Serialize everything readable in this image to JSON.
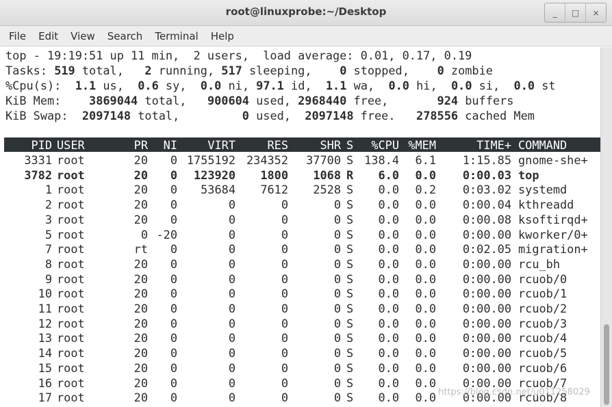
{
  "window": {
    "title": "root@linuxprobe:~/Desktop",
    "controls": {
      "minimize": "_",
      "maximize": "□",
      "close": "×"
    }
  },
  "menubar": {
    "items": [
      "File",
      "Edit",
      "View",
      "Search",
      "Terminal",
      "Help"
    ]
  },
  "summary": {
    "line1": "top - 19:19:51 up 11 min,  2 users,  load average: 0.01, 0.17, 0.19",
    "tasks": {
      "label": "Tasks:",
      "total": "519",
      "total_label": " total,",
      "running": "2",
      "running_label": " running,",
      "sleeping": "517",
      "sleeping_label": " sleeping,",
      "stopped": "0",
      "stopped_label": " stopped,",
      "zombie": "0",
      "zombie_label": " zombie"
    },
    "cpu": {
      "label": "%Cpu(s):",
      "us": "1.1",
      "us_label": " us,",
      "sy": "0.6",
      "sy_label": " sy,",
      "ni": "0.0",
      "ni_label": " ni,",
      "id": "97.1",
      "id_label": " id,",
      "wa": "1.1",
      "wa_label": " wa,",
      "hi": "0.0",
      "hi_label": " hi,",
      "si": "0.0",
      "si_label": " si,",
      "st": "0.0",
      "st_label": " st"
    },
    "mem": {
      "label": "KiB Mem:",
      "total": "3869044",
      "total_label": " total,",
      "used": "900604",
      "used_label": " used,",
      "free": "2968440",
      "free_label": " free,",
      "buffers": "924",
      "buffers_label": " buffers"
    },
    "swap": {
      "label": "KiB Swap:",
      "total": "2097148",
      "total_label": " total,",
      "used": "0",
      "used_label": " used,",
      "free": "2097148",
      "free_label": " free.",
      "cached": "278556",
      "cached_label": " cached Mem"
    }
  },
  "columns": [
    "PID",
    "USER",
    "PR",
    "NI",
    "VIRT",
    "RES",
    "SHR",
    "S",
    "%CPU",
    "%MEM",
    "TIME+",
    "COMMAND"
  ],
  "processes": [
    {
      "pid": "3331",
      "user": "root",
      "pr": "20",
      "ni": "0",
      "virt": "1755192",
      "res": "234352",
      "shr": "37700",
      "s": "S",
      "cpu": "138.4",
      "mem": "6.1",
      "time": "1:15.85",
      "command": "gnome-she+",
      "bold": false
    },
    {
      "pid": "3782",
      "user": "root",
      "pr": "20",
      "ni": "0",
      "virt": "123920",
      "res": "1800",
      "shr": "1068",
      "s": "R",
      "cpu": "6.0",
      "mem": "0.0",
      "time": "0:00.03",
      "command": "top",
      "bold": true
    },
    {
      "pid": "1",
      "user": "root",
      "pr": "20",
      "ni": "0",
      "virt": "53684",
      "res": "7612",
      "shr": "2528",
      "s": "S",
      "cpu": "0.0",
      "mem": "0.2",
      "time": "0:03.02",
      "command": "systemd",
      "bold": false
    },
    {
      "pid": "2",
      "user": "root",
      "pr": "20",
      "ni": "0",
      "virt": "0",
      "res": "0",
      "shr": "0",
      "s": "S",
      "cpu": "0.0",
      "mem": "0.0",
      "time": "0:00.04",
      "command": "kthreadd",
      "bold": false
    },
    {
      "pid": "3",
      "user": "root",
      "pr": "20",
      "ni": "0",
      "virt": "0",
      "res": "0",
      "shr": "0",
      "s": "S",
      "cpu": "0.0",
      "mem": "0.0",
      "time": "0:00.08",
      "command": "ksoftirqd+",
      "bold": false
    },
    {
      "pid": "5",
      "user": "root",
      "pr": "0",
      "ni": "-20",
      "virt": "0",
      "res": "0",
      "shr": "0",
      "s": "S",
      "cpu": "0.0",
      "mem": "0.0",
      "time": "0:00.00",
      "command": "kworker/0+",
      "bold": false
    },
    {
      "pid": "7",
      "user": "root",
      "pr": "rt",
      "ni": "0",
      "virt": "0",
      "res": "0",
      "shr": "0",
      "s": "S",
      "cpu": "0.0",
      "mem": "0.0",
      "time": "0:02.05",
      "command": "migration+",
      "bold": false
    },
    {
      "pid": "8",
      "user": "root",
      "pr": "20",
      "ni": "0",
      "virt": "0",
      "res": "0",
      "shr": "0",
      "s": "S",
      "cpu": "0.0",
      "mem": "0.0",
      "time": "0:00.00",
      "command": "rcu_bh",
      "bold": false
    },
    {
      "pid": "9",
      "user": "root",
      "pr": "20",
      "ni": "0",
      "virt": "0",
      "res": "0",
      "shr": "0",
      "s": "S",
      "cpu": "0.0",
      "mem": "0.0",
      "time": "0:00.00",
      "command": "rcuob/0",
      "bold": false
    },
    {
      "pid": "10",
      "user": "root",
      "pr": "20",
      "ni": "0",
      "virt": "0",
      "res": "0",
      "shr": "0",
      "s": "S",
      "cpu": "0.0",
      "mem": "0.0",
      "time": "0:00.00",
      "command": "rcuob/1",
      "bold": false
    },
    {
      "pid": "11",
      "user": "root",
      "pr": "20",
      "ni": "0",
      "virt": "0",
      "res": "0",
      "shr": "0",
      "s": "S",
      "cpu": "0.0",
      "mem": "0.0",
      "time": "0:00.00",
      "command": "rcuob/2",
      "bold": false
    },
    {
      "pid": "12",
      "user": "root",
      "pr": "20",
      "ni": "0",
      "virt": "0",
      "res": "0",
      "shr": "0",
      "s": "S",
      "cpu": "0.0",
      "mem": "0.0",
      "time": "0:00.00",
      "command": "rcuob/3",
      "bold": false
    },
    {
      "pid": "13",
      "user": "root",
      "pr": "20",
      "ni": "0",
      "virt": "0",
      "res": "0",
      "shr": "0",
      "s": "S",
      "cpu": "0.0",
      "mem": "0.0",
      "time": "0:00.00",
      "command": "rcuob/4",
      "bold": false
    },
    {
      "pid": "14",
      "user": "root",
      "pr": "20",
      "ni": "0",
      "virt": "0",
      "res": "0",
      "shr": "0",
      "s": "S",
      "cpu": "0.0",
      "mem": "0.0",
      "time": "0:00.00",
      "command": "rcuob/5",
      "bold": false
    },
    {
      "pid": "15",
      "user": "root",
      "pr": "20",
      "ni": "0",
      "virt": "0",
      "res": "0",
      "shr": "0",
      "s": "S",
      "cpu": "0.0",
      "mem": "0.0",
      "time": "0:00.00",
      "command": "rcuob/6",
      "bold": false
    },
    {
      "pid": "16",
      "user": "root",
      "pr": "20",
      "ni": "0",
      "virt": "0",
      "res": "0",
      "shr": "0",
      "s": "S",
      "cpu": "0.0",
      "mem": "0.0",
      "time": "0:00.00",
      "command": "rcuob/7",
      "bold": false
    },
    {
      "pid": "17",
      "user": "root",
      "pr": "20",
      "ni": "0",
      "virt": "0",
      "res": "0",
      "shr": "0",
      "s": "S",
      "cpu": "0.0",
      "mem": "0.0",
      "time": "0:00.00",
      "command": "rcuob/8",
      "bold": false
    }
  ],
  "watermark": "https://blog.csdn.net/u011258029"
}
